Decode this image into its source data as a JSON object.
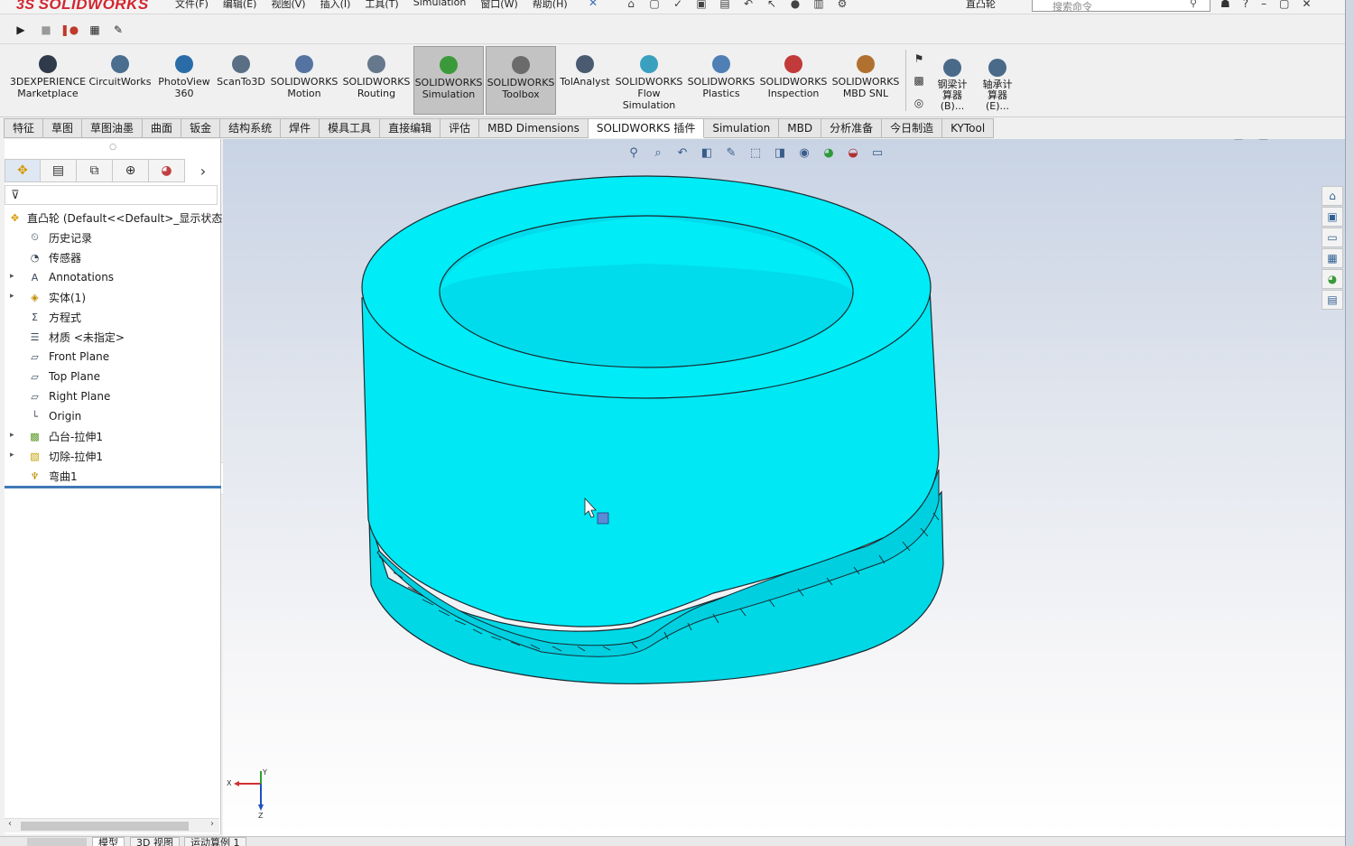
{
  "titlebar": {
    "brand_ds": "3S",
    "brand_name": "SOLIDWORKS",
    "menus": [
      "文件(F)",
      "编辑(E)",
      "视图(V)",
      "插入(I)",
      "工具(T)",
      "Simulation",
      "窗口(W)",
      "帮助(H)"
    ],
    "doc_title": "直凸轮",
    "search_placeholder": "搜索命令"
  },
  "command_manager": {
    "buttons": [
      {
        "label": "3DEXPERIENCE\nMarketplace",
        "icon": "marketplace-icon",
        "color": "#2f3a4a"
      },
      {
        "label": "CircuitWorks",
        "icon": "circuitworks-icon",
        "color": "#4b6e8e"
      },
      {
        "label": "PhotoView\n360",
        "icon": "photoview-icon",
        "color": "#2a6ca8"
      },
      {
        "label": "ScanTo3D",
        "icon": "scanto3d-icon",
        "color": "#5a6f86"
      },
      {
        "label": "SOLIDWORKS\nMotion",
        "icon": "motion-icon",
        "color": "#5573a0"
      },
      {
        "label": "SOLIDWORKS\nRouting",
        "icon": "routing-icon",
        "color": "#66788c"
      },
      {
        "label": "SOLIDWORKS\nSimulation",
        "icon": "simulation-icon",
        "color": "#3a9a3a",
        "active": true
      },
      {
        "label": "SOLIDWORKS\nToolbox",
        "icon": "toolbox-icon",
        "color": "#6b6b6b",
        "active": true
      },
      {
        "label": "TolAnalyst",
        "icon": "tolanalyst-icon",
        "color": "#4a5a70"
      },
      {
        "label": "SOLIDWORKS\nFlow\nSimulation",
        "icon": "flow-simulation-icon",
        "color": "#3aa0c0"
      },
      {
        "label": "SOLIDWORKS\nPlastics",
        "icon": "plastics-icon",
        "color": "#4f7fb5"
      },
      {
        "label": "SOLIDWORKS\nInspection",
        "icon": "inspection-icon",
        "color": "#c23a3a"
      },
      {
        "label": "SOLIDWORKS\nMBD SNL",
        "icon": "mbd-snl-icon",
        "color": "#b07030"
      },
      {
        "label": "钢梁计\n算器\n(B)...",
        "icon": "beam-calculator-icon",
        "color": "#4a6a8a"
      },
      {
        "label": "轴承计\n算器\n(E)...",
        "icon": "bearing-calculator-icon",
        "color": "#4a6a8a"
      }
    ]
  },
  "tabs": [
    {
      "label": "特征"
    },
    {
      "label": "草图"
    },
    {
      "label": "草图油墨"
    },
    {
      "label": "曲面"
    },
    {
      "label": "钣金"
    },
    {
      "label": "结构系统"
    },
    {
      "label": "焊件"
    },
    {
      "label": "模具工具"
    },
    {
      "label": "直接编辑"
    },
    {
      "label": "评估"
    },
    {
      "label": "MBD Dimensions"
    },
    {
      "label": "SOLIDWORKS 插件",
      "active": true
    },
    {
      "label": "Simulation"
    },
    {
      "label": "MBD"
    },
    {
      "label": "分析准备"
    },
    {
      "label": "今日制造"
    },
    {
      "label": "KYTool"
    }
  ],
  "feature_tree": {
    "root": "直凸轮  (Default<<Default>_显示状态",
    "items": [
      {
        "label": "历史记录",
        "icon": "history-icon",
        "expandable": false
      },
      {
        "label": "传感器",
        "icon": "sensor-icon",
        "expandable": false
      },
      {
        "label": "Annotations",
        "icon": "annotations-icon",
        "expandable": true
      },
      {
        "label": "实体(1)",
        "icon": "solid-bodies-icon",
        "expandable": true
      },
      {
        "label": "方程式",
        "icon": "equations-icon",
        "expandable": false
      },
      {
        "label": "材质 <未指定>",
        "icon": "material-icon",
        "expandable": false
      },
      {
        "label": "Front Plane",
        "icon": "plane-icon",
        "expandable": false
      },
      {
        "label": "Top Plane",
        "icon": "plane-icon",
        "expandable": false
      },
      {
        "label": "Right Plane",
        "icon": "plane-icon",
        "expandable": false
      },
      {
        "label": "Origin",
        "icon": "origin-icon",
        "expandable": false
      },
      {
        "label": "凸台-拉伸1",
        "icon": "boss-extrude-icon",
        "expandable": true
      },
      {
        "label": "切除-拉伸1",
        "icon": "cut-extrude-icon",
        "expandable": true
      },
      {
        "label": "弯曲1",
        "icon": "flex-icon",
        "expandable": false
      }
    ]
  },
  "bottom_tabs": [
    {
      "label": "模型",
      "active": true
    },
    {
      "label": "3D 视图"
    },
    {
      "label": "运动算例 1"
    }
  ],
  "colors": {
    "model_face": "#00e8f4",
    "model_edge": "#1a2a30",
    "accent": "#3f7ab8",
    "brand": "#d22630"
  }
}
